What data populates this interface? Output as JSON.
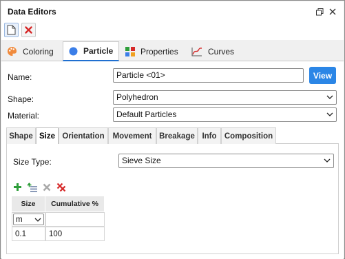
{
  "window": {
    "title": "Data Editors"
  },
  "toolbar": {
    "new_icon": "new-document-icon",
    "delete_icon": "delete-icon"
  },
  "main_tabs": [
    {
      "label": "Coloring",
      "icon": "palette-icon"
    },
    {
      "label": "Particle",
      "icon": "particle-icon",
      "active": true
    },
    {
      "label": "Properties",
      "icon": "properties-grid-icon"
    },
    {
      "label": "Curves",
      "icon": "curve-chart-icon"
    }
  ],
  "form": {
    "name_label": "Name:",
    "name_value": "Particle <01>",
    "view_button": "View",
    "shape_label": "Shape:",
    "shape_value": "Polyhedron",
    "material_label": "Material:",
    "material_value": "Default Particles"
  },
  "sub_tabs": [
    {
      "label": "Shape"
    },
    {
      "label": "Size",
      "active": true
    },
    {
      "label": "Orientation"
    },
    {
      "label": "Movement"
    },
    {
      "label": "Breakage"
    },
    {
      "label": "Info"
    },
    {
      "label": "Composition"
    }
  ],
  "size_panel": {
    "size_type_label": "Size Type:",
    "size_type_value": "Sieve Size"
  },
  "table": {
    "headers": [
      "Size",
      "Cumulative %"
    ],
    "unit_value": "m",
    "rows": [
      [
        "0.1",
        "100"
      ]
    ]
  },
  "colors": {
    "accent": "#2b86e6",
    "add": "#2e9e3a",
    "delete": "#d62828"
  }
}
